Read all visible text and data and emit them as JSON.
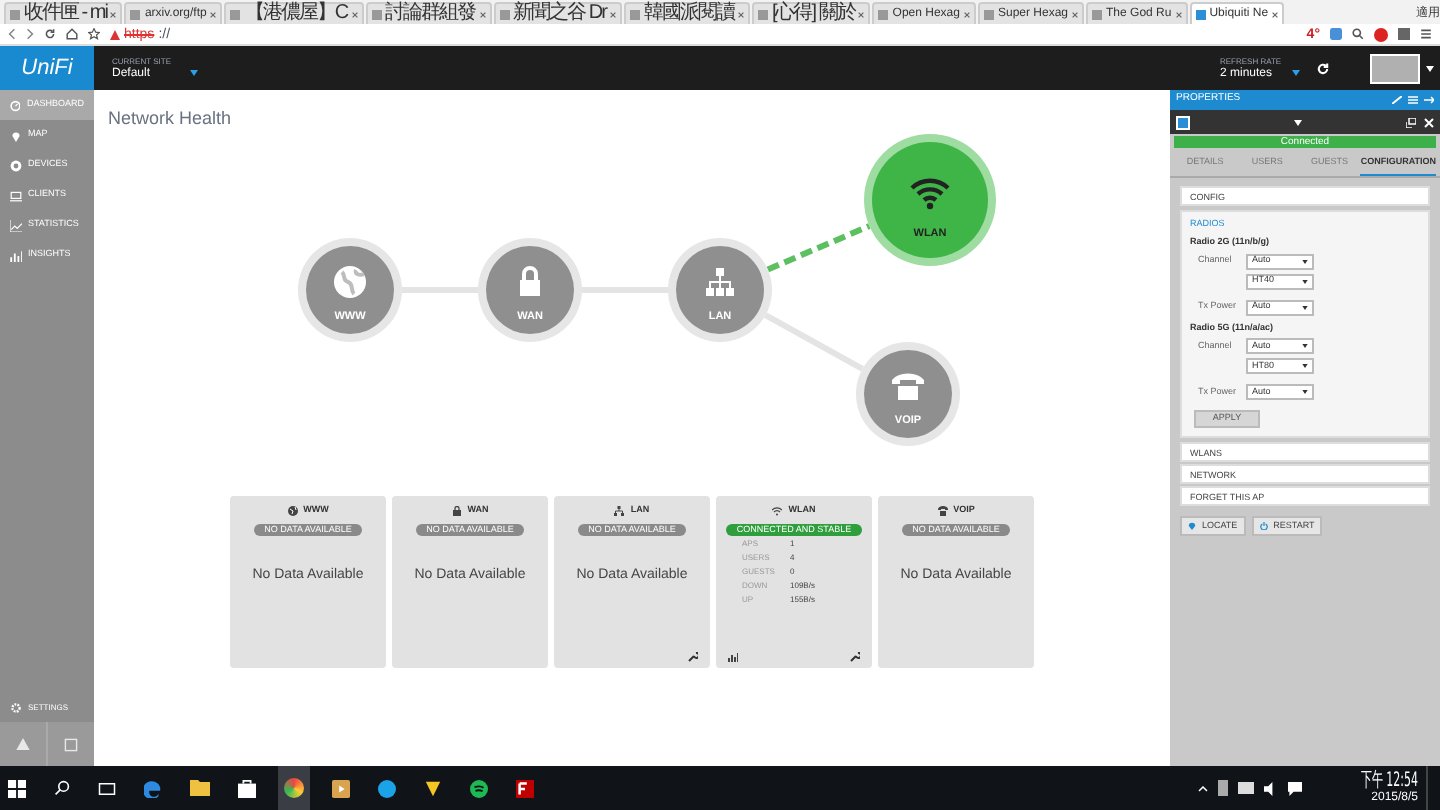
{
  "browser": {
    "tabs": [
      {
        "title": "收件匣 - mi",
        "selected": false
      },
      {
        "title": "arxiv.org/ftp",
        "selected": false
      },
      {
        "title": "【港儂屋】C",
        "selected": false
      },
      {
        "title": "討論群組發",
        "selected": false
      },
      {
        "title": "新聞之谷 Dr",
        "selected": false
      },
      {
        "title": "韓國派閱讀",
        "selected": false
      },
      {
        "title": "[心得] 關於",
        "selected": false
      },
      {
        "title": "Open Hexag",
        "selected": false
      },
      {
        "title": "Super Hexag",
        "selected": false
      },
      {
        "title": "The God Ru",
        "selected": false
      },
      {
        "title": "Ubiquiti Ne",
        "selected": true
      }
    ],
    "user_label": "適用",
    "url_scheme": "https",
    "url_rest": "://",
    "weather": "4°"
  },
  "header": {
    "logo": "UniFi",
    "site_label": "CURRENT SITE",
    "site": "Default",
    "refresh_label": "REFRESH RATE",
    "refresh": "2 minutes"
  },
  "sidebar": {
    "items": [
      {
        "label": "DASHBOARD",
        "selected": true
      },
      {
        "label": "MAP",
        "selected": false
      },
      {
        "label": "DEVICES",
        "selected": false
      },
      {
        "label": "CLIENTS",
        "selected": false
      },
      {
        "label": "STATISTICS",
        "selected": false
      },
      {
        "label": "INSIGHTS",
        "selected": false
      }
    ],
    "settings": "SETTINGS"
  },
  "main": {
    "title": "Network Health",
    "nodes": [
      {
        "label": "WWW",
        "connected": false
      },
      {
        "label": "WAN",
        "connected": false
      },
      {
        "label": "LAN",
        "connected": false
      },
      {
        "label": "WLAN",
        "connected": true
      },
      {
        "label": "VOIP",
        "connected": false
      }
    ],
    "cards": [
      {
        "title": "WWW",
        "connected": false,
        "badge": "NO DATA AVAILABLE",
        "text": "No Data Available"
      },
      {
        "title": "WAN",
        "connected": false,
        "badge": "NO DATA AVAILABLE",
        "text": "No Data Available"
      },
      {
        "title": "LAN",
        "connected": false,
        "badge": "NO DATA AVAILABLE",
        "text": "No Data Available",
        "has_wrench": true
      },
      {
        "title": "WLAN",
        "connected": true,
        "badge": "CONNECTED AND STABLE",
        "stats": [
          {
            "label": "APS",
            "value": "1"
          },
          {
            "label": "USERS",
            "value": "4"
          },
          {
            "label": "GUESTS",
            "value": "0"
          },
          {
            "label": "DOWN",
            "value": "109B/s"
          },
          {
            "label": "UP",
            "value": "155B/s"
          }
        ],
        "has_chart": true,
        "has_wrench": true
      },
      {
        "title": "VOIP",
        "connected": false,
        "badge": "NO DATA AVAILABLE",
        "text": "No Data Available"
      }
    ]
  },
  "properties": {
    "title": "PROPERTIES",
    "state": "Connected",
    "tabs": [
      {
        "label": "DETAILS",
        "selected": false
      },
      {
        "label": "USERS",
        "selected": false
      },
      {
        "label": "GUESTS",
        "selected": false
      },
      {
        "label": "CONFIGURATION",
        "selected": true
      }
    ],
    "sections": [
      {
        "label": "CONFIG",
        "expanded": false
      },
      {
        "label": "RADIOS",
        "expanded": true
      }
    ],
    "radios": [
      {
        "name": "Radio 2G (11n/b/g)",
        "channel_label": "Channel",
        "channel": "Auto",
        "width": "HT40",
        "power_label": "Tx Power",
        "power": "Auto"
      },
      {
        "name": "Radio 5G (11n/a/ac)",
        "channel_label": "Channel",
        "channel": "Auto",
        "width": "HT80",
        "power_label": "Tx Power",
        "power": "Auto"
      }
    ],
    "apply": "APPLY",
    "more_sections": [
      "WLANS",
      "NETWORK",
      "FORGET THIS AP"
    ],
    "actions": [
      "LOCATE",
      "RESTART"
    ]
  },
  "taskbar": {
    "time": "下午 12:54",
    "date": "2015/8/5"
  }
}
